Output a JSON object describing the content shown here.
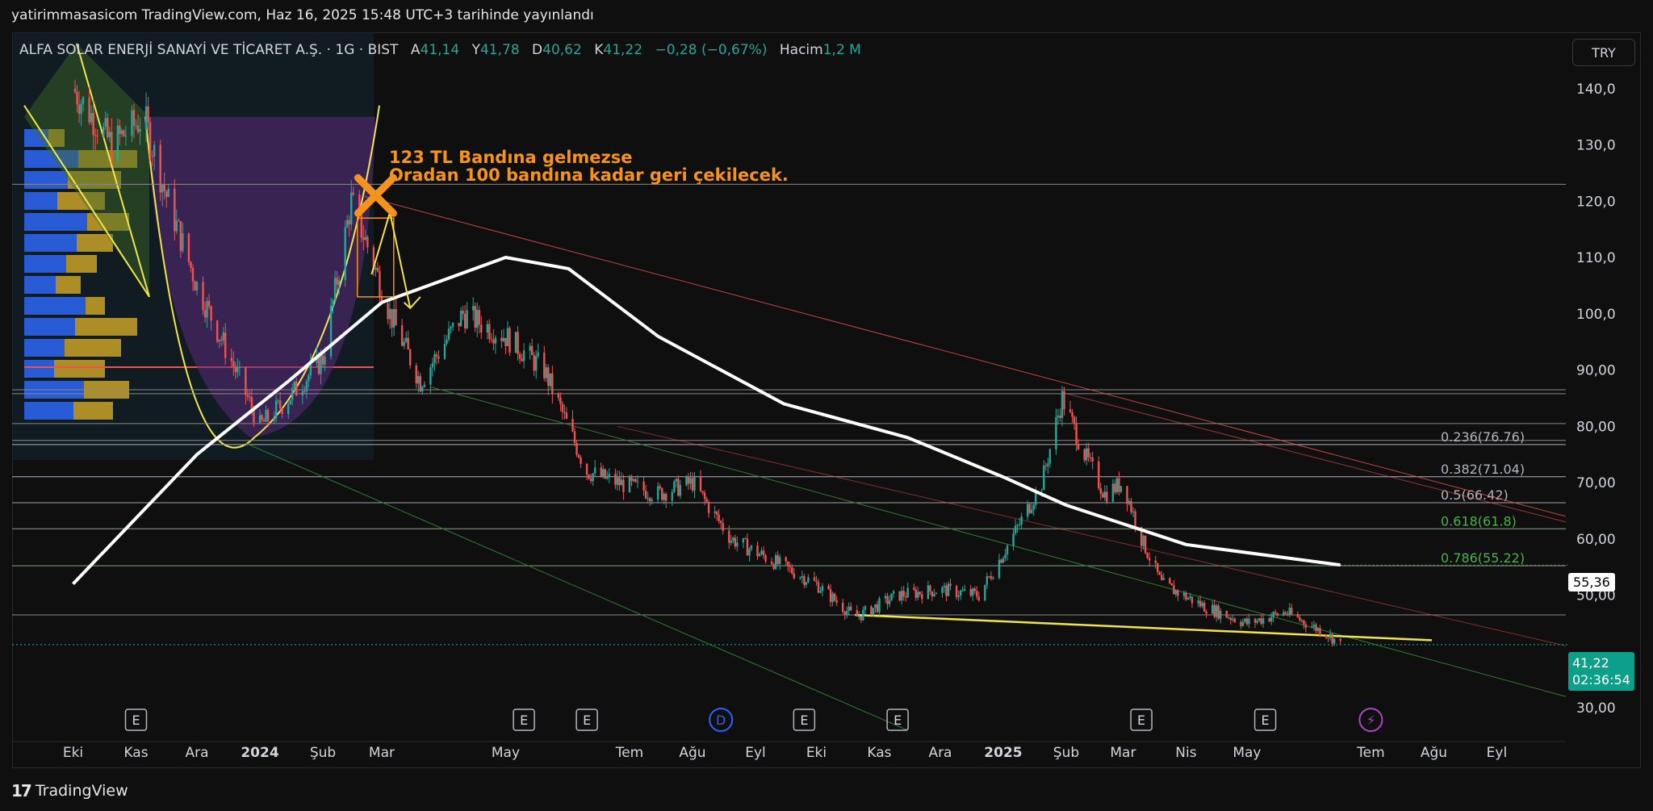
{
  "publication": "yatirimmasasicom TradingView.com, Haz 16, 2025 15:48 UTC+3 tarihinde yayınlandı",
  "legend": {
    "symbol": "ALFA SOLAR ENERJİ SANAYİ VE TİCARET A.Ş. · 1G · BIST",
    "open_label": "A",
    "open": "41,14",
    "high_label": "Y",
    "high": "41,78",
    "low_label": "D",
    "low": "40,62",
    "close_label": "K",
    "close": "41,22",
    "change": "−0,28 (−0,67%)",
    "volume_label": "Hacim",
    "volume": "1,2 M"
  },
  "currency_button": "TRY",
  "ema_tag": "55,36",
  "price_tag": {
    "price": "41,22",
    "countdown": "02:36:54"
  },
  "brand": "TradingView",
  "annotation": {
    "line1": "123 TL Bandına gelmezse",
    "line2": "Oradan 100 bandına kadar geri çekilecek.",
    "color": "#f7931a"
  },
  "colors": {
    "up": "#26a69a",
    "down": "#ef5350",
    "ema": "#ffffff",
    "accent": "#f7931a",
    "trend": "#f2e54b",
    "background": "#0f0f0f"
  },
  "chart_data": {
    "type": "candlestick",
    "symbol": "ALFA SOLAR ENERJİ SANAYİ VE TİCARET A.Ş.",
    "interval": "1G",
    "y_ticks": [
      "140,0",
      "130,0",
      "120,0",
      "110,0",
      "100,0",
      "90,00",
      "80,00",
      "70,00",
      "60,00",
      "50,00",
      "30,00"
    ],
    "y_tick_values": [
      140,
      130,
      120,
      110,
      100,
      90,
      80,
      70,
      60,
      50,
      30
    ],
    "ylim": [
      26,
      150
    ],
    "x_ticks": [
      "Eki",
      "Kas",
      "Ara",
      "2024",
      "Şub",
      "Mar",
      "May",
      "Tem",
      "Ağu",
      "Eyl",
      "Eki",
      "Kas",
      "Ara",
      "2025",
      "Şub",
      "Mar",
      "Nis",
      "May",
      "Tem",
      "Ağu",
      "Eyl"
    ],
    "price_path": [
      [
        "2023-10-01",
        140
      ],
      [
        "2023-10-20",
        130
      ],
      [
        "2023-11-05",
        135
      ],
      [
        "2023-11-15",
        122
      ],
      [
        "2023-12-01",
        105
      ],
      [
        "2023-12-20",
        90
      ],
      [
        "2024-01-01",
        80
      ],
      [
        "2024-01-15",
        85
      ],
      [
        "2024-02-01",
        92
      ],
      [
        "2024-02-15",
        120
      ],
      [
        "2024-02-25",
        110
      ],
      [
        "2024-03-05",
        100
      ],
      [
        "2024-03-20",
        88
      ],
      [
        "2024-04-10",
        100
      ],
      [
        "2024-05-01",
        96
      ],
      [
        "2024-05-20",
        90
      ],
      [
        "2024-06-10",
        72
      ],
      [
        "2024-06-25",
        70
      ],
      [
        "2024-07-15",
        68
      ],
      [
        "2024-08-01",
        70
      ],
      [
        "2024-08-20",
        60
      ],
      [
        "2024-09-10",
        56
      ],
      [
        "2024-10-01",
        52
      ],
      [
        "2024-10-20",
        46
      ],
      [
        "2024-11-10",
        50
      ],
      [
        "2024-12-01",
        51
      ],
      [
        "2024-12-20",
        50
      ],
      [
        "2025-01-05",
        60
      ],
      [
        "2025-01-20",
        70
      ],
      [
        "2025-01-30",
        85
      ],
      [
        "2025-02-10",
        75
      ],
      [
        "2025-02-20",
        68
      ],
      [
        "2025-03-01",
        70
      ],
      [
        "2025-03-10",
        60
      ],
      [
        "2025-03-20",
        52
      ],
      [
        "2025-04-10",
        48
      ],
      [
        "2025-05-01",
        45
      ],
      [
        "2025-05-20",
        47
      ],
      [
        "2025-06-10",
        43
      ],
      [
        "2025-06-16",
        41.22
      ]
    ],
    "ema_path": [
      [
        "2023-10-01",
        52
      ],
      [
        "2023-12-01",
        75
      ],
      [
        "2024-01-15",
        88
      ],
      [
        "2024-03-01",
        102
      ],
      [
        "2024-05-01",
        110
      ],
      [
        "2024-06-01",
        108
      ],
      [
        "2024-07-15",
        96
      ],
      [
        "2024-09-15",
        84
      ],
      [
        "2024-11-15",
        78
      ],
      [
        "2025-01-01",
        71
      ],
      [
        "2025-02-01",
        66
      ],
      [
        "2025-04-01",
        59
      ],
      [
        "2025-06-16",
        55.36
      ]
    ],
    "horizontal_levels": [
      123,
      86.5,
      85.8,
      80.5,
      77.5,
      76.76,
      71.04,
      66.42,
      61.8,
      55.22,
      46.5
    ],
    "fibonacci": [
      {
        "label": "0.236(76.76)",
        "value": 76.76,
        "color": "#b2b5be"
      },
      {
        "label": "0.382(71.04)",
        "value": 71.04,
        "color": "#b2b5be"
      },
      {
        "label": "0.5(66.42)",
        "value": 66.42,
        "color": "#b2b5be"
      },
      {
        "label": "0.618(61.8)",
        "value": 61.8,
        "color": "#4caf50"
      },
      {
        "label": "0.786(55.22)",
        "value": 55.22,
        "color": "#4caf50"
      }
    ],
    "support_trendline": [
      [
        "2024-10-20",
        46.5
      ],
      [
        "2025-07-31",
        42
      ]
    ],
    "events": [
      {
        "type": "E",
        "date": "2023-11-01"
      },
      {
        "type": "E",
        "date": "2024-05-10"
      },
      {
        "type": "E",
        "date": "2024-06-10"
      },
      {
        "type": "D",
        "date": "2024-08-15"
      },
      {
        "type": "E",
        "date": "2024-09-25"
      },
      {
        "type": "E",
        "date": "2024-11-10"
      },
      {
        "type": "E",
        "date": "2025-03-10"
      },
      {
        "type": "E",
        "date": "2025-05-10"
      },
      {
        "type": "⚡",
        "date": "2025-07-01"
      }
    ]
  }
}
